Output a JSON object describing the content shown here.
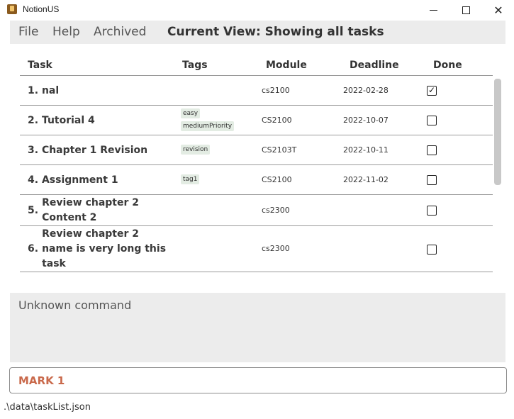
{
  "window": {
    "title": "NotionUS",
    "icon": "app-logo-icon",
    "controls": {
      "minimize_icon": "minimize-icon",
      "maximize_icon": "maximize-icon",
      "close_glyph": "✕"
    }
  },
  "menubar": {
    "file_label": "File",
    "help_label": "Help",
    "archived_label": "Archived",
    "current_view": "Current View: Showing all tasks"
  },
  "table": {
    "headers": {
      "task": "Task",
      "tags": "Tags",
      "module": "Module",
      "deadline": "Deadline",
      "done": "Done"
    },
    "rows": [
      {
        "num": "1.",
        "name": "nal",
        "tags": [],
        "module": "cs2100",
        "deadline": "2022-02-28",
        "done": true
      },
      {
        "num": "2.",
        "name": "Tutorial 4",
        "tags": [
          "easy",
          "mediumPriority"
        ],
        "module": "CS2100",
        "deadline": "2022-10-07",
        "done": false
      },
      {
        "num": "3.",
        "name": "Chapter 1 Revision",
        "tags": [
          "revision"
        ],
        "module": "CS2103T",
        "deadline": "2022-10-11",
        "done": false
      },
      {
        "num": "4.",
        "name": "Assignment 1",
        "tags": [
          "tag1"
        ],
        "module": "CS2100",
        "deadline": "2022-11-02",
        "done": false
      },
      {
        "num": "5.",
        "name_lines": [
          "Review chapter 2",
          "Content 2"
        ],
        "tags": [],
        "module": "cs2300",
        "deadline": "",
        "done": false
      },
      {
        "num": "6.",
        "name_lines": [
          "Review chapter 2",
          "name is very long this",
          "task"
        ],
        "tags": [],
        "module": "cs2300",
        "deadline": "",
        "done": false
      }
    ],
    "check_glyph": "✓"
  },
  "result": {
    "text": "Unknown command"
  },
  "command": {
    "value": "MARK 1"
  },
  "status": {
    "file_path": ".\\data\\taskList.json"
  },
  "colors": {
    "accent_command": "#c9694b",
    "panel_bg": "#ececec",
    "tag_bg": "#e3ece3"
  }
}
